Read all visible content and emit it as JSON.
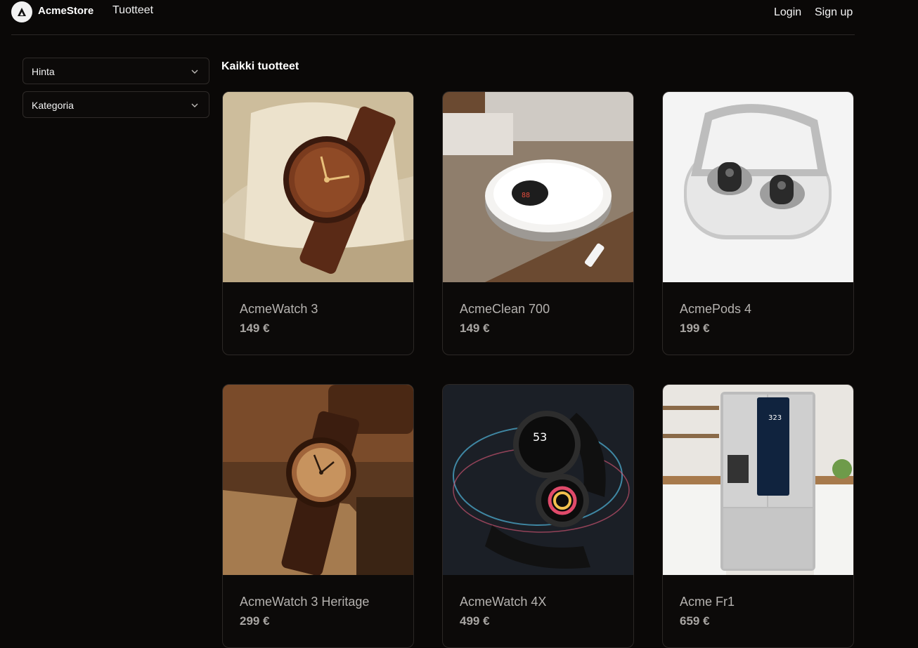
{
  "header": {
    "brand": "AcmeStore",
    "nav_products": "Tuotteet",
    "login": "Login",
    "signup": "Sign up",
    "logo_icon": "acme-logo-icon"
  },
  "filters": [
    {
      "label": "Hinta",
      "icon": "chevron-down-icon"
    },
    {
      "label": "Kategoria",
      "icon": "chevron-down-icon"
    }
  ],
  "section_title": "Kaikki tuotteet",
  "products": [
    {
      "name": "AcmeWatch 3",
      "price": "149 €",
      "image": "wooden-watch-on-pillow"
    },
    {
      "name": "AcmeClean 700",
      "price": "149 €",
      "image": "robot-vacuum-on-rug"
    },
    {
      "name": "AcmePods 4",
      "price": "199 €",
      "image": "earbuds-in-case"
    },
    {
      "name": "AcmeWatch 3 Heritage",
      "price": "299 €",
      "image": "wooden-watch-on-desk"
    },
    {
      "name": "AcmeWatch 4X",
      "price": "499 €",
      "image": "smartwatch-black-strap"
    },
    {
      "name": "Acme Fr1",
      "price": "659 €",
      "image": "smart-fridge-kitchen"
    }
  ],
  "colors": {
    "background": "#0a0807",
    "card_border": "#2c2826",
    "text_primary": "#ffffff",
    "text_muted": "#b5b2af"
  }
}
